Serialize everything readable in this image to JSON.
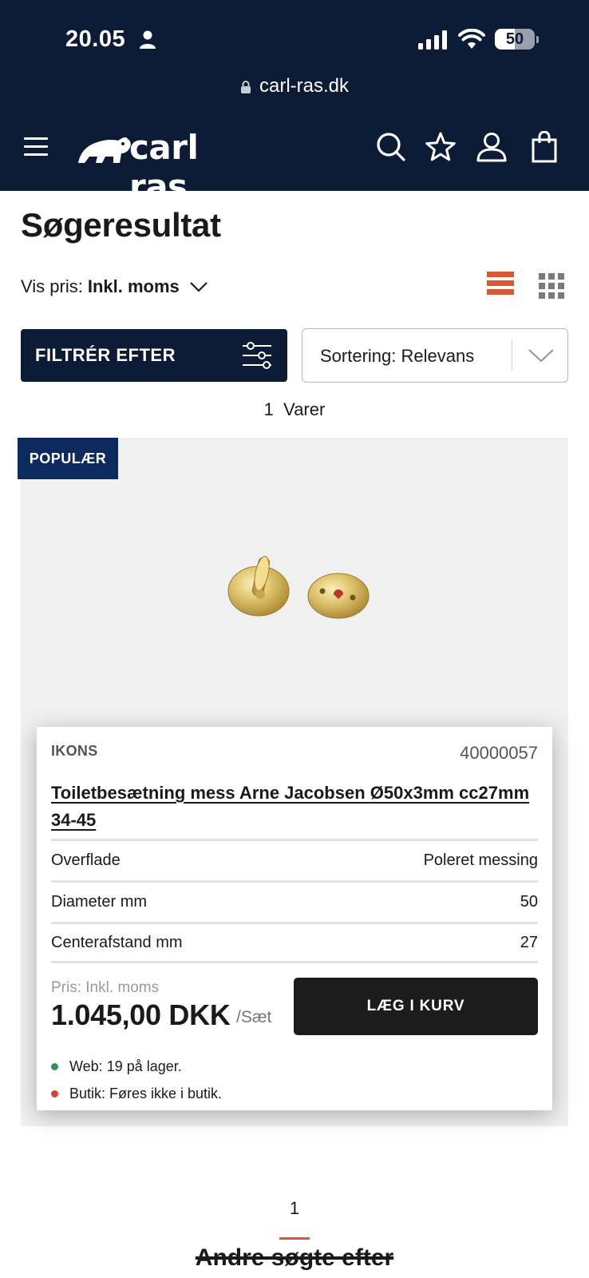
{
  "status_bar": {
    "time": "20.05",
    "battery_percent": "50",
    "battery_level": 0.5
  },
  "browser": {
    "url": "carl-ras.dk"
  },
  "header": {
    "logo_text": "carl ras",
    "icons": [
      "menu-icon",
      "search-icon",
      "star-icon",
      "user-icon",
      "bag-icon"
    ]
  },
  "page": {
    "title": "Søgeresultat",
    "vat_prefix": "Vis pris:",
    "vat_value": "Inkl. moms",
    "filter_label": "FILTRÉR EFTER",
    "sort_label": "Sortering: Relevans",
    "result_count": "1",
    "result_label": "Varer"
  },
  "product": {
    "badge": "POPULÆR",
    "brand": "IKONS",
    "sku": "40000057",
    "name": "Toiletbesætning mess Arne Jacobsen Ø50x3mm cc27mm 34-45",
    "specs": [
      {
        "label": "Overflade",
        "value": "Poleret messing"
      },
      {
        "label": "Diameter mm",
        "value": "50"
      },
      {
        "label": "Centerafstand mm",
        "value": "27"
      }
    ],
    "price_label": "Pris: Inkl. moms",
    "price": "1.045,00 DKK",
    "unit": "/Sæt",
    "cart_button": "LÆG I KURV",
    "stock_web": "Web: 19 på lager.",
    "stock_shop": "Butik: Føres ikke i butik."
  },
  "pagination": {
    "current": "1"
  },
  "footer": {
    "other_searches": "Andre søgte efter"
  },
  "colors": {
    "header_bg": "#0d1c36",
    "accent": "#d75a36",
    "badge_bg": "#0d2a5e",
    "stock_ok": "#3e8a5a",
    "stock_no": "#d2452b"
  }
}
